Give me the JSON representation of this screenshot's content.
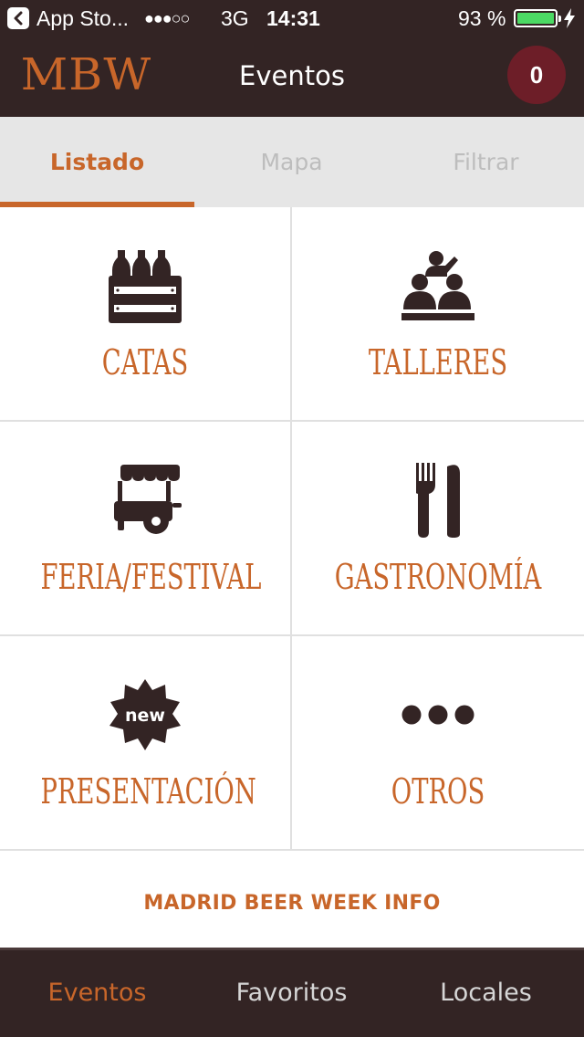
{
  "status_bar": {
    "back_app": "App Sto...",
    "signal": "●●●○○",
    "network": "3G",
    "time": "14:31",
    "battery": "93 %",
    "battery_level": 0.93
  },
  "header": {
    "logo": "MBW",
    "title": "Eventos",
    "cart_count": "0"
  },
  "tabs": [
    {
      "label": "Listado",
      "active": true
    },
    {
      "label": "Mapa",
      "active": false
    },
    {
      "label": "Filtrar",
      "active": false
    }
  ],
  "categories": [
    {
      "label": "CATAS",
      "icon": "beer-crate-icon"
    },
    {
      "label": "TALLERES",
      "icon": "workshop-people-icon"
    },
    {
      "label": "FERIA/FESTIVAL",
      "icon": "food-cart-icon"
    },
    {
      "label": "GASTRONOMÍA",
      "icon": "fork-knife-icon"
    },
    {
      "label": "PRESENTACIÓN",
      "icon": "new-badge-icon",
      "icon_text": "new"
    },
    {
      "label": "OTROS",
      "icon": "more-dots-icon"
    }
  ],
  "info": {
    "label": "MADRID BEER WEEK INFO"
  },
  "bottom_tabs": [
    {
      "label": "Eventos",
      "active": true
    },
    {
      "label": "Favoritos",
      "active": false
    },
    {
      "label": "Locales",
      "active": false
    }
  ],
  "colors": {
    "accent": "#c8662a",
    "dark": "#332424",
    "icon": "#332424",
    "badge": "#6d1e28"
  }
}
